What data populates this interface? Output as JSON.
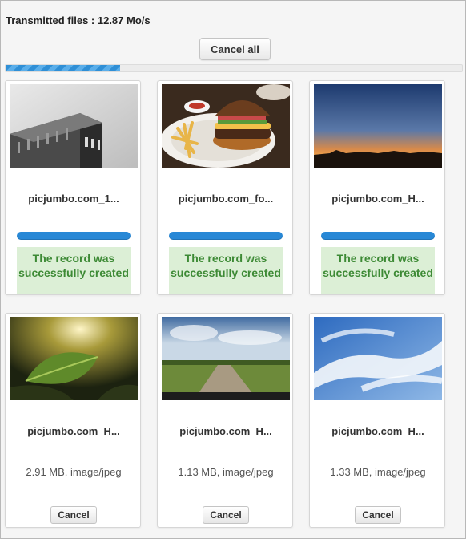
{
  "header": {
    "transmitted_label": "Transmitted files : 12.87 Mo/s",
    "cancel_all_label": "Cancel all",
    "overall_progress": 0.25
  },
  "colors": {
    "accent": "#2888d6",
    "success_bg": "#dcefd6",
    "success_text": "#3d8a35"
  },
  "files": [
    {
      "name": "picjumbo.com_1...",
      "status": "The record was successfully created",
      "thumbnail": "building-photo"
    },
    {
      "name": "picjumbo.com_fo...",
      "status": "The record was successfully created",
      "thumbnail": "burger-photo"
    },
    {
      "name": "picjumbo.com_H...",
      "status": "The record was successfully created",
      "thumbnail": "sunset-photo"
    },
    {
      "name": "picjumbo.com_H...",
      "meta": "2.91 MB, image/jpeg",
      "cancel_label": "Cancel",
      "thumbnail": "leaf-photo"
    },
    {
      "name": "picjumbo.com_H...",
      "meta": "1.13 MB, image/jpeg",
      "cancel_label": "Cancel",
      "thumbnail": "field-road-photo"
    },
    {
      "name": "picjumbo.com_H...",
      "meta": "1.33 MB, image/jpeg",
      "cancel_label": "Cancel",
      "thumbnail": "sky-clouds-photo"
    }
  ]
}
